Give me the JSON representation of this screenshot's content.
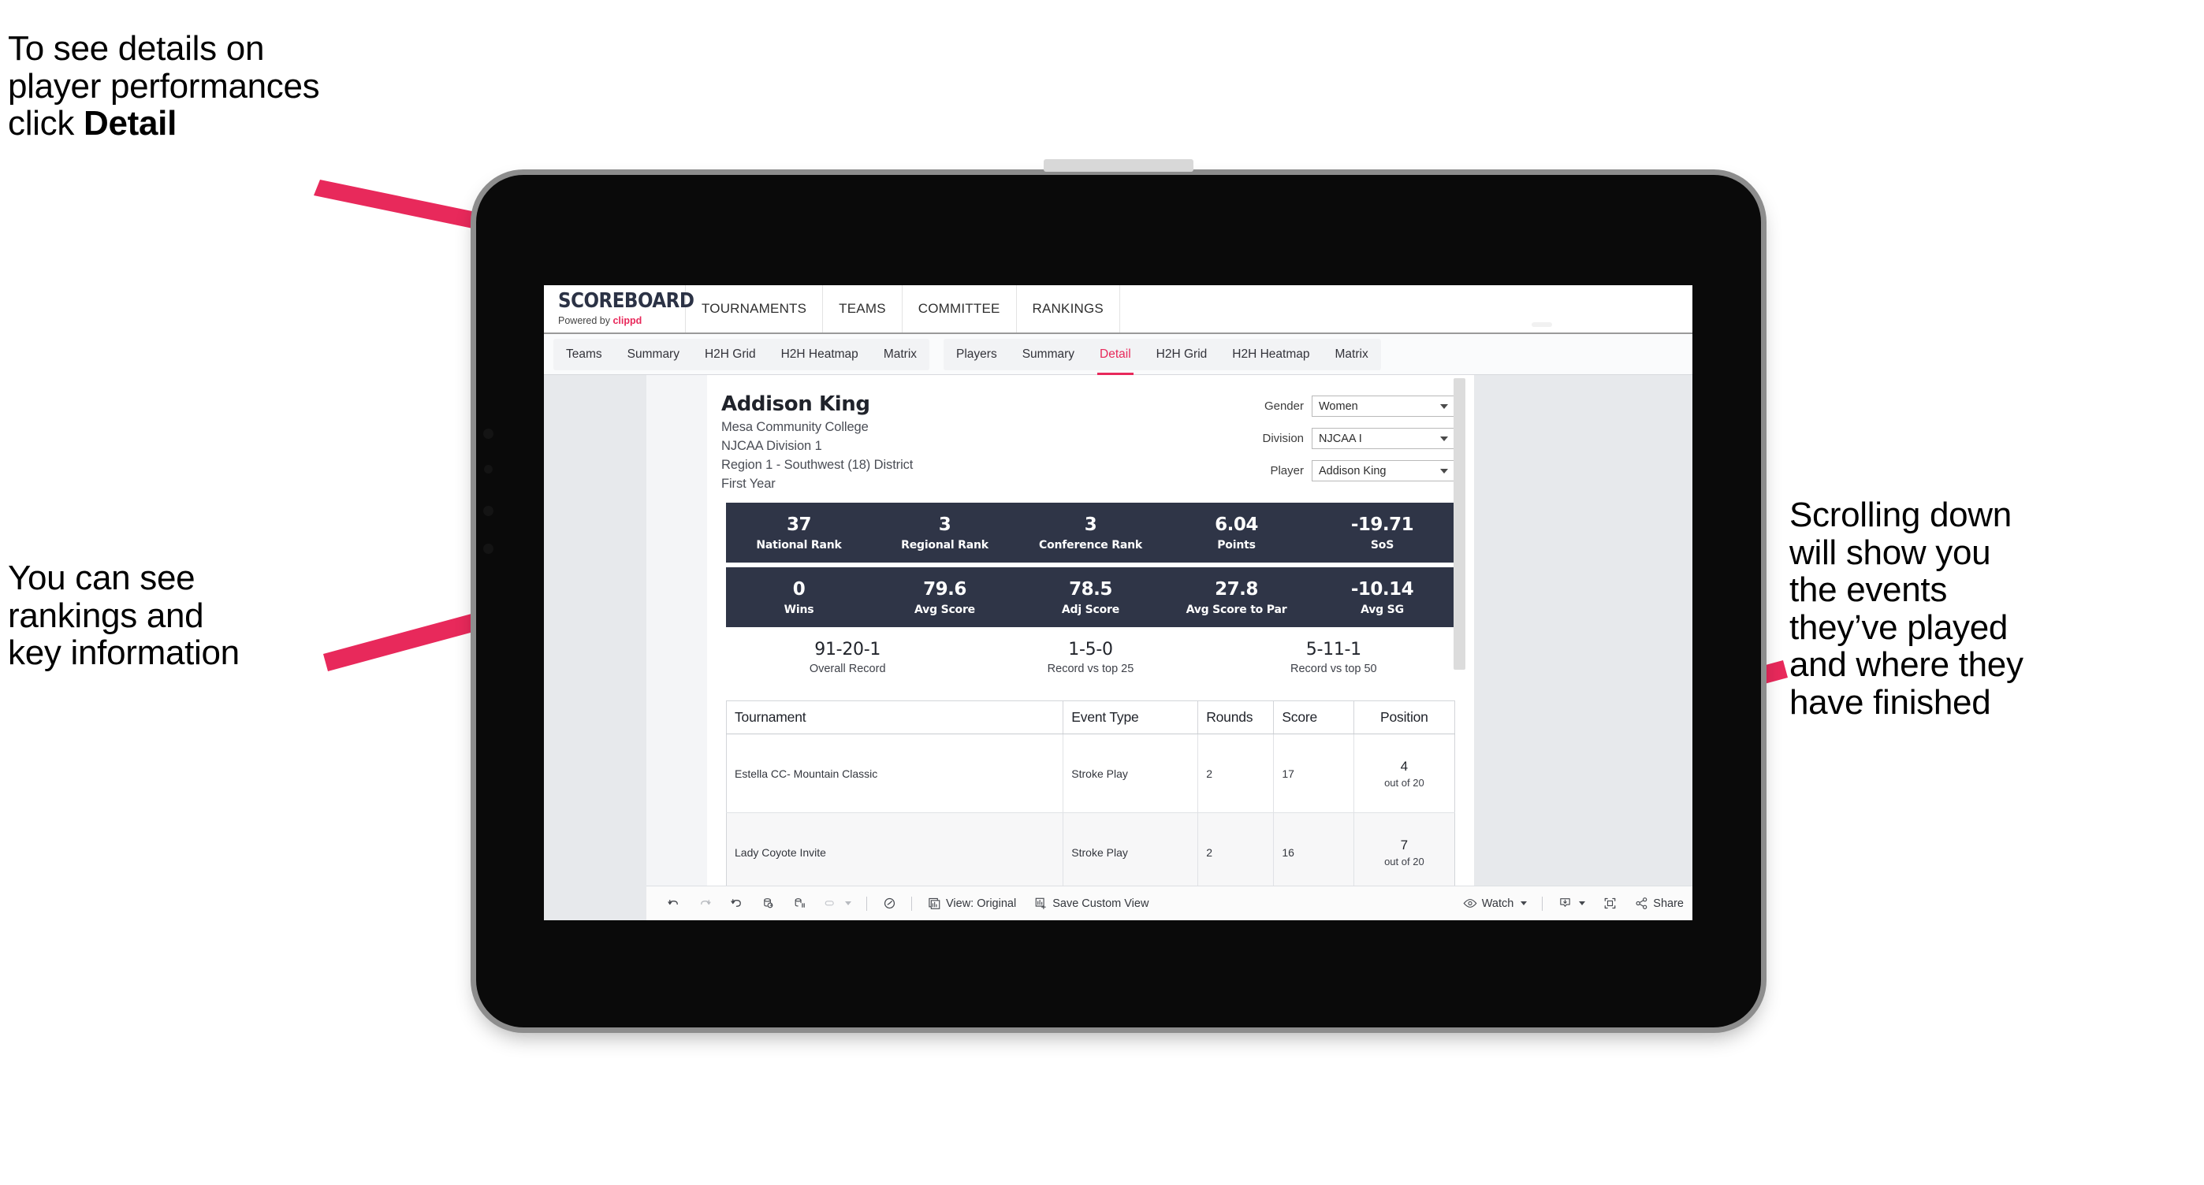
{
  "annotations": {
    "detail_note": "To see details on\nplayer performances\nclick ",
    "detail_note_bold": "Detail",
    "rankings_note": "You can see\nrankings and\nkey information",
    "scroll_note": "Scrolling down\nwill show you\nthe events\nthey’ve played\nand where they\nhave finished",
    "arrow_color": "#e8295b"
  },
  "brand": {
    "logo_word": "SCOREBOARD",
    "powered_by_prefix": "Powered by ",
    "powered_by_name": "clippd",
    "accent_color": "#e8295b"
  },
  "topnav": {
    "items": [
      {
        "label": "TOURNAMENTS"
      },
      {
        "label": "TEAMS"
      },
      {
        "label": "COMMITTEE"
      },
      {
        "label": "RANKINGS"
      }
    ]
  },
  "subnav": {
    "group_teams": [
      {
        "label": "Teams",
        "active": false
      },
      {
        "label": "Summary",
        "active": false
      },
      {
        "label": "H2H Grid",
        "active": false
      },
      {
        "label": "H2H Heatmap",
        "active": false
      },
      {
        "label": "Matrix",
        "active": false
      }
    ],
    "group_players": [
      {
        "label": "Players",
        "active": false
      },
      {
        "label": "Summary",
        "active": false
      },
      {
        "label": "Detail",
        "active": true
      },
      {
        "label": "H2H Grid",
        "active": false
      },
      {
        "label": "H2H Heatmap",
        "active": false
      },
      {
        "label": "Matrix",
        "active": false
      }
    ]
  },
  "player": {
    "name": "Addison King",
    "school": "Mesa Community College",
    "division": "NJCAA Division 1",
    "region": "Region 1 - Southwest (18) District",
    "class_year": "First Year"
  },
  "filters": [
    {
      "label": "Gender",
      "value": "Women"
    },
    {
      "label": "Division",
      "value": "NJCAA I"
    },
    {
      "label": "Player",
      "value": "Addison King"
    }
  ],
  "stats_row1": [
    {
      "value": "37",
      "label": "National Rank"
    },
    {
      "value": "3",
      "label": "Regional Rank"
    },
    {
      "value": "3",
      "label": "Conference Rank"
    },
    {
      "value": "6.04",
      "label": "Points"
    },
    {
      "value": "-19.71",
      "label": "SoS"
    }
  ],
  "stats_row2": [
    {
      "value": "0",
      "label": "Wins"
    },
    {
      "value": "79.6",
      "label": "Avg Score"
    },
    {
      "value": "78.5",
      "label": "Adj Score"
    },
    {
      "value": "27.8",
      "label": "Avg Score to Par"
    },
    {
      "value": "-10.14",
      "label": "Avg SG"
    }
  ],
  "records": [
    {
      "value": "91-20-1",
      "label": "Overall Record"
    },
    {
      "value": "1-5-0",
      "label": "Record vs top 25"
    },
    {
      "value": "5-11-1",
      "label": "Record vs top 50"
    }
  ],
  "events_table": {
    "columns": [
      "Tournament",
      "Event Type",
      "Rounds",
      "Score",
      "Position"
    ],
    "rows": [
      {
        "tournament": "Estella CC- Mountain Classic",
        "event_type": "Stroke Play",
        "rounds": "2",
        "score": "17",
        "position_num": "4",
        "position_out": "out of 20"
      },
      {
        "tournament": "Lady Coyote Invite",
        "event_type": "Stroke Play",
        "rounds": "2",
        "score": "16",
        "position_num": "7",
        "position_out": "out of 20"
      }
    ]
  },
  "toolbar": {
    "undo": "undo-icon",
    "redo": "redo-icon",
    "revert": "revert-icon",
    "refresh": "refresh-data-icon",
    "pause": "pause-auto-update-icon",
    "highlight": "highlight-icon",
    "clock": "dashboard-clock-icon",
    "view_label": "View: Original",
    "save_custom_view": "Save Custom View",
    "watch": "Watch",
    "share": "Share"
  }
}
